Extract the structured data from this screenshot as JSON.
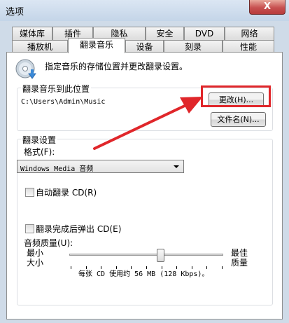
{
  "window": {
    "title": "选项",
    "close_label": "X"
  },
  "tabs_row1": [
    "媒体库",
    "插件",
    "隐私",
    "安全",
    "DVD",
    "网络"
  ],
  "tabs_row2": [
    "播放机",
    "翻录音乐",
    "设备",
    "刻录",
    "性能"
  ],
  "active_tab": "翻录音乐",
  "intro": {
    "text": "指定音乐的存储位置并更改翻录设置。",
    "icon": "cd-disc-icon"
  },
  "location": {
    "legend": "翻录音乐到此位置",
    "path": "C:\\Users\\Admin\\Music",
    "change_button": "更改(H)...",
    "filename_button": "文件名(N)..."
  },
  "settings": {
    "legend": "翻录设置",
    "format_label": "格式(F):",
    "format_value": "Windows Media 音频",
    "auto_rip_label": "自动翻录 CD(R)",
    "auto_rip_checked": false,
    "eject_label": "翻录完成后弹出 CD(E)",
    "eject_checked": false,
    "quality_label": "音频质量(U):",
    "quality_min_line1": "最小",
    "quality_min_line2": "大小",
    "quality_max_line1": "最佳",
    "quality_max_line2": "质量",
    "quality_level_fraction": 0.59,
    "quality_info": "每张 CD 使用约 56 MB (128 Kbps)。"
  },
  "annotation_color": "#e0262a"
}
